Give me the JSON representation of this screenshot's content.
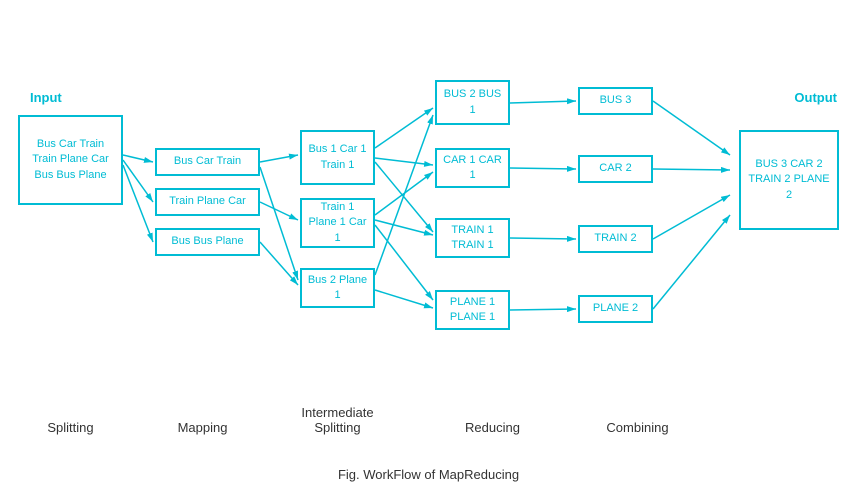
{
  "title": "Fig. WorkFlow of MapReducing",
  "labels": {
    "input": "Input",
    "output": "Output",
    "splitting": "Splitting",
    "mapping": "Mapping",
    "intermediate_splitting": "Intermediate\nSplitting",
    "reducing": "Reducing",
    "combining": "Combining"
  },
  "boxes": {
    "input": "Bus Car Train\nTrain Plane Car\nBus Bus Plane",
    "map1": "Bus Car Train",
    "map2": "Train Plane Car",
    "map3": "Bus Bus Plane",
    "split1": "Bus 1\nCar 1\nTrain 1",
    "split2": "Train 1\nPlane 1\nCar 1",
    "split3": "Bus 2\nPlane 1",
    "inter1": "BUS 2\nBUS 1",
    "inter2": "CAR 1\nCAR 1",
    "inter3": "TRAIN 1\nTRAIN 1",
    "inter4": "PLANE 1\nPLANE 1",
    "reduce1": "BUS 3",
    "reduce2": "CAR  2",
    "reduce3": "TRAIN 2",
    "reduce4": "PLANE 2",
    "output": "BUS 3\nCAR 2\nTRAIN 2\nPLANE 2"
  }
}
